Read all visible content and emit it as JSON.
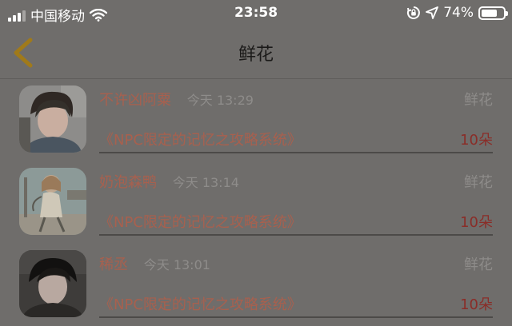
{
  "status": {
    "carrier": "中国移动",
    "time": "23:58",
    "battery_label": "74%",
    "battery_level": 0.74
  },
  "nav": {
    "title": "鲜花"
  },
  "items": [
    {
      "name": "不许凶阿粟",
      "time": "今天 13:29",
      "type": "鲜花",
      "book": "《NPC限定的记忆之攻略系统》",
      "count": "10朵"
    },
    {
      "name": "奶泡森鸭",
      "time": "今天 13:14",
      "type": "鲜花",
      "book": "《NPC限定的记忆之攻略系统》",
      "count": "10朵"
    },
    {
      "name": "稀丞",
      "time": "今天 13:01",
      "type": "鲜花",
      "book": "《NPC限定的记忆之攻略系统》",
      "count": "10朵"
    }
  ],
  "colors": {
    "overlay_bg": "#6f6d6b",
    "accent_text": "#a8604e",
    "count_text": "#8a2d28",
    "back_arrow": "#a07a1a"
  }
}
